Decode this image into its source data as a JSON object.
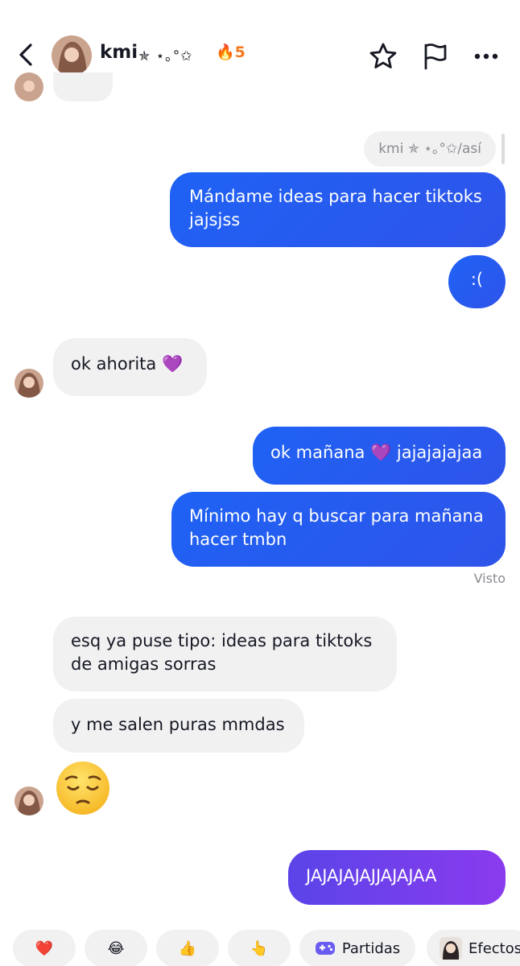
{
  "header": {
    "contact_name": "kmi",
    "name_decoration": "✯ ⋆｡°✩",
    "streak_count": "5",
    "streak_icon": "fire-icon",
    "actions": [
      "star-icon",
      "flag-icon",
      "more-icon"
    ]
  },
  "reply_reference": "kmi ✯ ⋆｡°✩/así",
  "messages": [
    {
      "from": "me",
      "text": "Mándame ideas para hacer tiktoks jajsjss"
    },
    {
      "from": "me",
      "text": ":("
    },
    {
      "from": "kmi",
      "text": "ok ahorita 💜"
    },
    {
      "from": "me",
      "text": "ok mañana 💜 jajajajajaa"
    },
    {
      "from": "me",
      "text": "Mínimo hay q buscar para mañana hacer tmbn"
    },
    {
      "from": "kmi",
      "text": "esq ya puse tipo: ideas para tiktoks de amigas sorras"
    },
    {
      "from": "kmi",
      "text": "y me salen puras mmdas"
    },
    {
      "from": "kmi",
      "text": "😔",
      "kind": "emoji"
    },
    {
      "from": "me",
      "text": "JAJAJAJAJJAJAJAA"
    }
  ],
  "status": {
    "seen": "Visto"
  },
  "quick_replies": [
    {
      "icon": "heart-emoji",
      "glyph": "❤️"
    },
    {
      "icon": "laughing-emoji",
      "glyph": "😂"
    },
    {
      "icon": "thumbs-up-emoji",
      "glyph": "👍"
    },
    {
      "icon": "pointing-up-emoji",
      "glyph": "👆"
    },
    {
      "icon": "gamepad-icon",
      "label": "Partidas"
    },
    {
      "icon": "effects-avatar",
      "label": "Efectos"
    }
  ]
}
